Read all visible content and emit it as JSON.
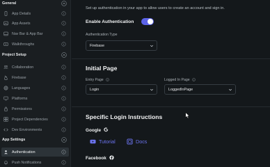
{
  "sidebar": {
    "general": {
      "title": "General",
      "items": [
        {
          "label": "App Details",
          "icon": "phone-icon"
        },
        {
          "label": "App Assets",
          "icon": "image-icon"
        },
        {
          "label": "Nav Bar & App Bar",
          "icon": "navbar-icon"
        },
        {
          "label": "Walkthroughs",
          "icon": "walkthrough-icon"
        }
      ]
    },
    "project_setup": {
      "title": "Project Setup",
      "items": [
        {
          "label": "Collaboration",
          "icon": "people-icon"
        },
        {
          "label": "Firebase",
          "icon": "firebase-icon"
        },
        {
          "label": "Languages",
          "icon": "globe-icon"
        },
        {
          "label": "Platforms",
          "icon": "platforms-icon"
        },
        {
          "label": "Permissions",
          "icon": "lock-icon"
        },
        {
          "label": "Project Dependencies",
          "icon": "dependencies-icon"
        },
        {
          "label": "Dev Environments",
          "icon": "code-icon"
        }
      ]
    },
    "app_settings": {
      "title": "App Settings",
      "items": [
        {
          "label": "Authentication",
          "icon": "user-icon"
        },
        {
          "label": "Push Notifications",
          "icon": "bell-icon"
        }
      ]
    }
  },
  "main": {
    "intro": "Set up authentication in your app to allow users to create an account and sign in.",
    "enable_label": "Enable Authentication",
    "enable_on": true,
    "auth_type_label": "Authentication Type",
    "auth_type_value": "Firebase",
    "initial_page": {
      "title": "Initial Page",
      "entry_label": "Entry Page",
      "entry_value": "Login",
      "logged_in_label": "Logged In Page",
      "logged_in_value": "LoggedInPage"
    },
    "login_instructions": {
      "title": "Specific Login Instructions",
      "google_label": "Google",
      "tutorial": "Tutorial",
      "docs": "Docs",
      "facebook_label": "Facebook"
    }
  },
  "colors": {
    "accent": "#5b63e8",
    "link": "#6c74f0",
    "background": "#14181b",
    "sidebar": "#1a1e21"
  }
}
